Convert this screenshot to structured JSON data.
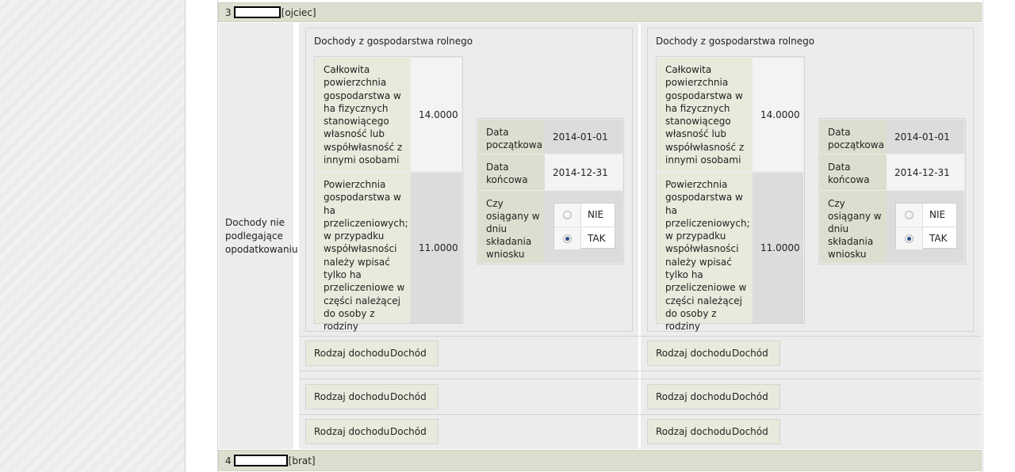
{
  "persons": [
    {
      "number": "3",
      "relation": "[ojciec]"
    },
    {
      "number": "4",
      "relation": "[brat]"
    }
  ],
  "section_label": "Dochody nie podlegające opodatkowaniu",
  "columns": [
    {
      "panel_title": "Dochody z gospodarstwa rolnego",
      "total_area_label": "Całkowita powierzchnia gospodarstwa w ha fizycznych stanowiącego własność lub współwłasność z innymi osobami",
      "total_area_value": "14.0000",
      "converted_area_label": "Powierzchnia gospodarstwa w ha przeliczeniowych; w przypadku współwłasności należy wpisać tylko ha przeliczeniowe w części należącej do osoby z rodziny",
      "converted_area_value": "11.0000",
      "start_date_label": "Data początkowa",
      "start_date_value": "2014-01-01",
      "end_date_label": "Data końcowa",
      "end_date_value": "2014-12-31",
      "achieved_label": "Czy osiągany w dniu składania wniosku",
      "options": [
        {
          "label": "NIE",
          "checked": false
        },
        {
          "label": "TAK",
          "checked": true
        }
      ]
    },
    {
      "panel_title": "Dochody z gospodarstwa rolnego",
      "total_area_label": "Całkowita powierzchnia gospodarstwa w ha fizycznych stanowiącego własność lub współwłasność z innymi osobami",
      "total_area_value": "14.0000",
      "converted_area_label": "Powierzchnia gospodarstwa w ha przeliczeniowych; w przypadku współwłasności należy wpisać tylko ha przeliczeniowe w części należącej do osoby z rodziny",
      "converted_area_value": "11.0000",
      "start_date_label": "Data początkowa",
      "start_date_value": "2014-01-01",
      "end_date_label": "Data końcowa",
      "end_date_value": "2014-12-31",
      "achieved_label": "Czy osiągany w dniu składania wniosku",
      "options": [
        {
          "label": "NIE",
          "checked": false
        },
        {
          "label": "TAK",
          "checked": true
        }
      ]
    }
  ],
  "income_row": {
    "type_label": "Rodzaj dochodu",
    "income_label": "Dochód"
  }
}
